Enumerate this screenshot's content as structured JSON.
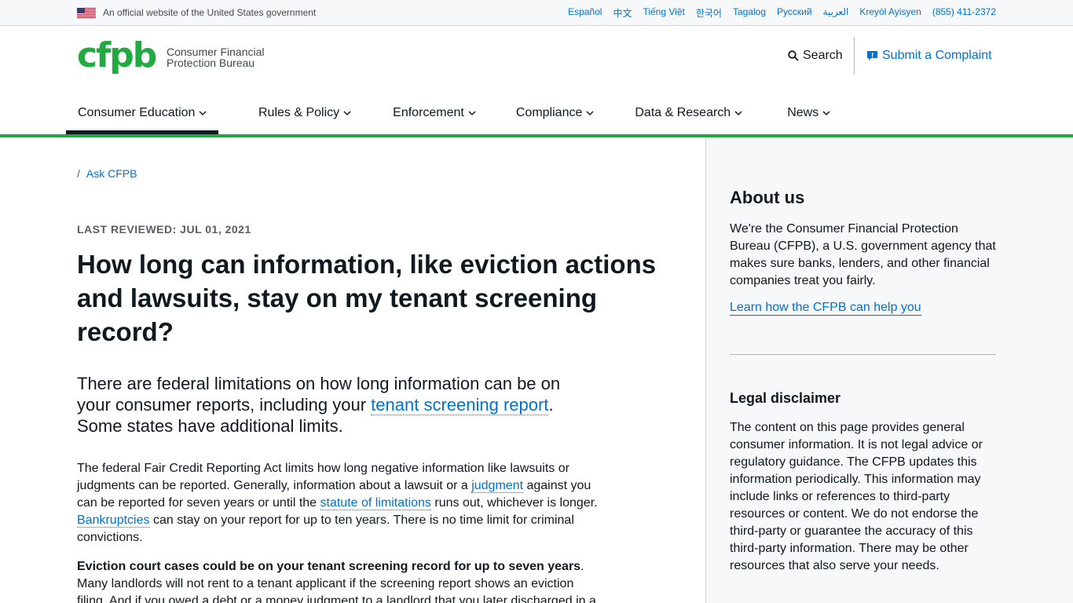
{
  "banner": {
    "official_text": "An official website of the United States government",
    "languages": [
      "Español",
      "中文",
      "Tiếng Việt",
      "한국어",
      "Tagalog",
      "Русский",
      "العربية",
      "Kreyòl Ayisyen",
      "(855) 411-2372"
    ]
  },
  "header": {
    "logo_mark": "cfpb",
    "logo_line1": "Consumer Financial",
    "logo_line2": "Protection Bureau",
    "search_label": "Search",
    "complaint_label": "Submit a Complaint"
  },
  "nav": {
    "items": [
      {
        "label": "Consumer Education"
      },
      {
        "label": "Rules & Policy"
      },
      {
        "label": "Enforcement"
      },
      {
        "label": "Compliance"
      },
      {
        "label": "Data & Research"
      },
      {
        "label": "News"
      }
    ]
  },
  "breadcrumb": {
    "separator": "/",
    "link": "Ask CFPB"
  },
  "article": {
    "reviewed": "LAST REVIEWED: JUL 01, 2021",
    "title": "How long can information, like eviction actions and lawsuits, stay on my tenant screening record?",
    "lead_1": "There are federal limitations on how long information can be on your consumer reports, including your ",
    "lead_link": "tenant screening report",
    "lead_2": ". Some states have additional limits.",
    "p1_a": "The federal Fair Credit Reporting Act limits how long negative information like lawsuits or judgments can be reported. Generally, information about a lawsuit or a ",
    "p1_link1": "judgment",
    "p1_b": " against you can be reported for seven years or until the ",
    "p1_link2": "statute of limitations",
    "p1_c": " runs out, whichever is longer. ",
    "p1_link3": "Bankruptcies",
    "p1_d": " can stay on your report for up to ten years. There is no time limit for criminal convictions.",
    "p2_bold": "Eviction court cases could be on your tenant screening record for up to seven years",
    "p2_rest": ". Many landlords will not rent to a tenant applicant if the screening report shows an eviction filing. And if you owed a debt or a money judgment to a landlord that you later discharged in a"
  },
  "sidebar": {
    "about_heading": "About us",
    "about_text": "We're the Consumer Financial Protection Bureau (CFPB), a U.S. government agency that makes sure banks, lenders, and other financial companies treat you fairly.",
    "about_link": "Learn how the CFPB can help you",
    "legal_heading": "Legal disclaimer",
    "legal_text": "The content on this page provides general consumer information. It is not legal advice or regulatory guidance. The CFPB updates this information periodically. This information may include links or references to third-party resources or content. We do not endorse the third-party or guarantee the accuracy of this third-party information. There may be other resources that also serve your needs."
  },
  "colors": {
    "brand_green": "#20aa3f",
    "link_blue": "#0072ce"
  },
  "icons": [
    "us-flag-icon",
    "search-icon",
    "complaint-icon",
    "chevron-down-icon"
  ]
}
